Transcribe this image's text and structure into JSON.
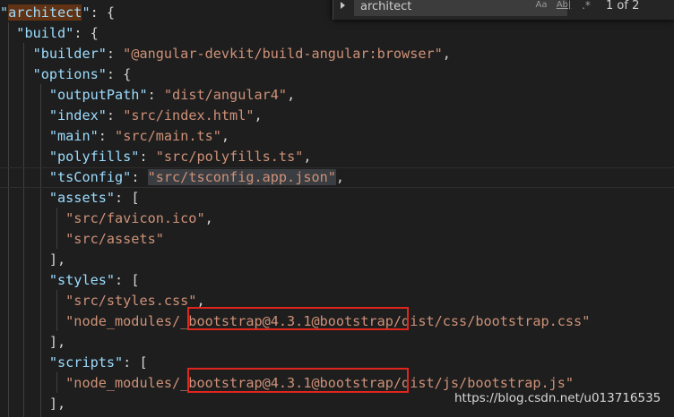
{
  "code": {
    "l1_key": "architect",
    "l1_rest": ": {",
    "l2_key": "\"build\"",
    "l2_rest": ": {",
    "l3_key": "\"builder\"",
    "l3_sep": ": ",
    "l3_val": "\"@angular-devkit/build-angular:browser\"",
    "l3_end": ",",
    "l4_key": "\"options\"",
    "l4_rest": ": {",
    "l5_key": "\"outputPath\"",
    "l5_sep": ": ",
    "l5_val": "\"dist/angular4\"",
    "l5_end": ",",
    "l6_key": "\"index\"",
    "l6_sep": ": ",
    "l6_val": "\"src/index.html\"",
    "l6_end": ",",
    "l7_key": "\"main\"",
    "l7_sep": ": ",
    "l7_val": "\"src/main.ts\"",
    "l7_end": ",",
    "l8_key": "\"polyfills\"",
    "l8_sep": ": ",
    "l8_val": "\"src/polyfills.ts\"",
    "l8_end": ",",
    "l9_key": "\"tsConfig\"",
    "l9_sep": ": ",
    "l9_val": "\"src/tsconfig.app.json\"",
    "l9_end": ",",
    "l10_key": "\"assets\"",
    "l10_rest": ": [",
    "l11_val": "\"src/favicon.ico\"",
    "l11_end": ",",
    "l12_val": "\"src/assets\"",
    "l13": "],",
    "l14_key": "\"styles\"",
    "l14_rest": ": [",
    "l15_val": "\"src/styles.css\"",
    "l15_end": ",",
    "l16_val": "\"node_modules/_bootstrap@4.3.1@bootstrap/dist/css/bootstrap.css\"",
    "l17": "],",
    "l18_key": "\"scripts\"",
    "l18_rest": ": [",
    "l19_val": "\"node_modules/_bootstrap@4.3.1@bootstrap/dist/js/bootstrap.js\"",
    "l20": "],"
  },
  "find": {
    "query": "architect",
    "case_label": "Aa",
    "word_label": "Ab|",
    "regex_label": ".*",
    "count": "1 of 2"
  },
  "watermark": "https://blog.csdn.net/u013716535"
}
